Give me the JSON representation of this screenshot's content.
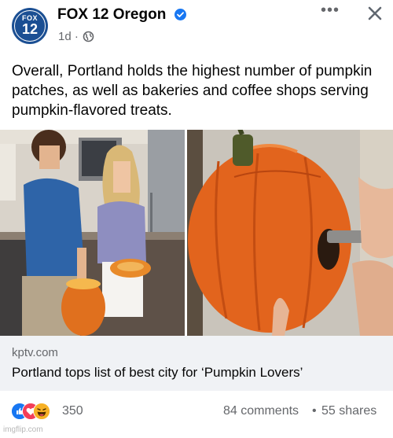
{
  "post": {
    "page_name": "FOX 12 Oregon",
    "logo_text_top": "FOX",
    "logo_text_bottom": "12",
    "time": "1d ·",
    "body": "Overall, Portland holds the highest number of pumpkin patches, as well as bakeries and coffee shops serving pumpkin-flavored treats."
  },
  "header": {
    "more_label": "•••"
  },
  "link": {
    "domain": "kptv.com",
    "title": "Portland tops list of best city for ‘Pumpkin Lovers’"
  },
  "stats": {
    "reaction_count": "350",
    "comments": "84 comments",
    "separator": "•",
    "shares": "55 shares"
  },
  "watermark": "imgflip.com",
  "colors": {
    "accent": "#1877f2",
    "secondary_text": "#65676b",
    "link_bg": "#f0f2f5",
    "logo_bg": "#1b4f93"
  },
  "icons": {
    "verified": "verified-badge-icon",
    "privacy": "globe-icon",
    "more": "more-options-icon",
    "close": "close-icon",
    "like": "like-reaction-icon",
    "love": "love-reaction-icon",
    "haha": "haha-reaction-icon"
  }
}
